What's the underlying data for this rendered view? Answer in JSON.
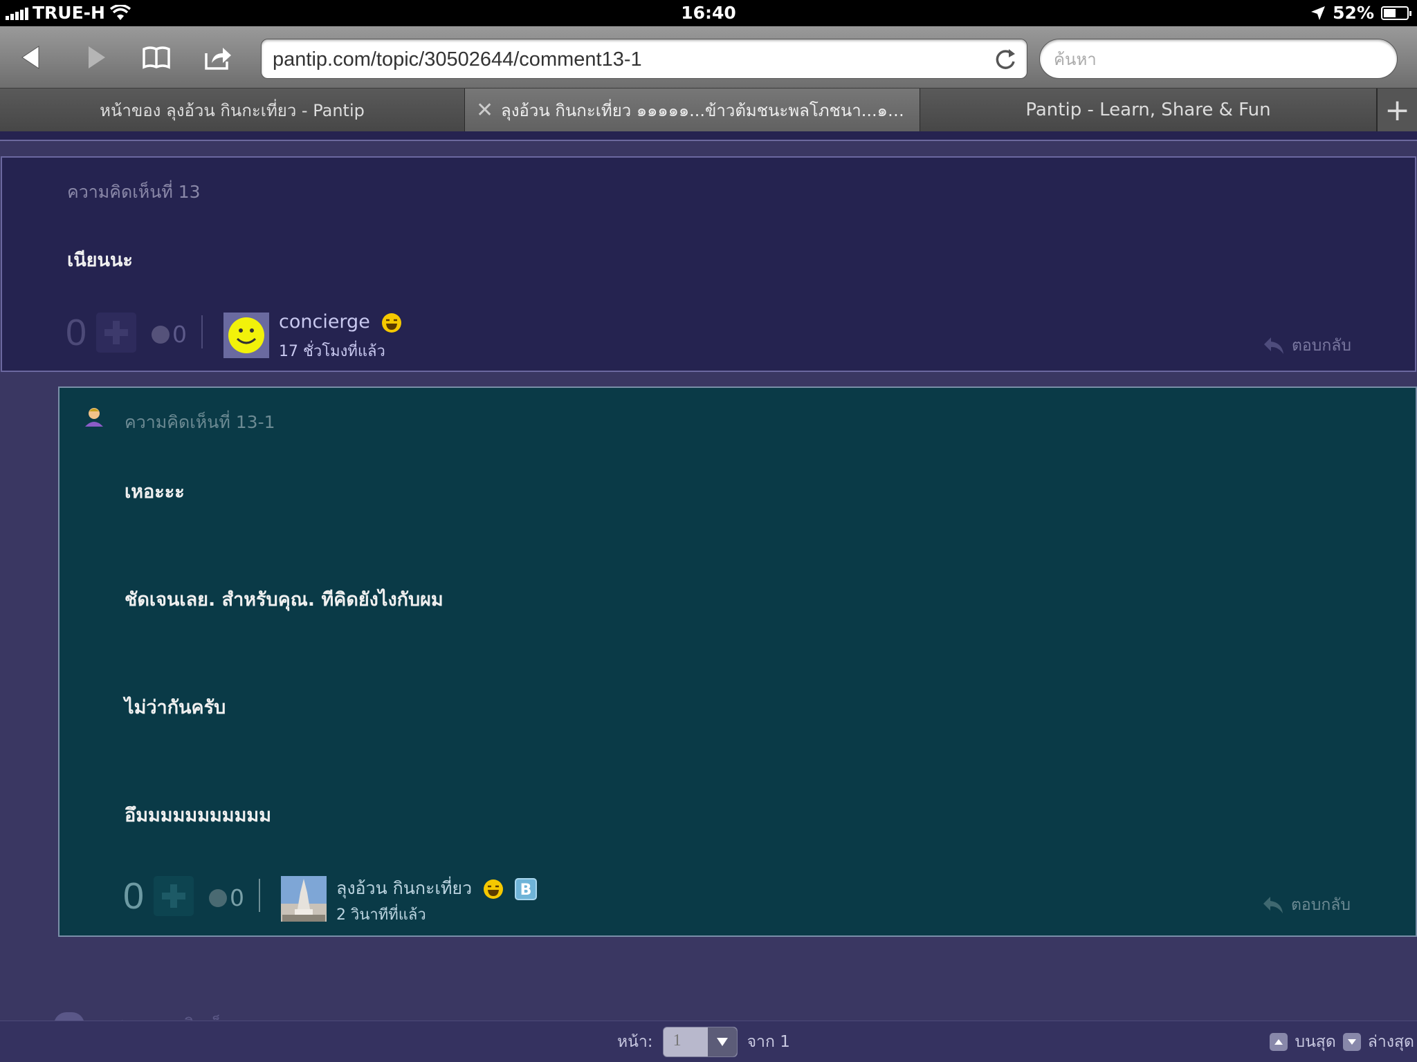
{
  "status_bar": {
    "carrier": "TRUE-H",
    "time": "16:40",
    "battery": "52%",
    "battery_level": 0.52
  },
  "browser": {
    "url": "pantip.com/topic/30502644/comment13-1",
    "search_placeholder": "ค้นหา",
    "tabs": [
      {
        "label": "หน้าของ ลุงอ้วน กินกะเที่ยว - Pantip"
      },
      {
        "label": "ลุงอ้วน กินกะเที่ยว ๑๑๑๑๑...ข้าวต้มชนะพลโภชนา...๑๑๑๑๑ -..."
      },
      {
        "label": "Pantip - Learn, Share & Fun"
      }
    ]
  },
  "comment_main": {
    "title": "ความคิดเห็นที่ 13",
    "text": "เนียนนะ",
    "score": "0",
    "emotion_count": "0",
    "username": "concierge",
    "time": "17 ชั่วโมงที่แล้ว",
    "reply_label": "ตอบกลับ"
  },
  "comment_reply": {
    "title": "ความคิดเห็นที่ 13-1",
    "lines": [
      "เหอะะะ",
      "ชัดเจนเลย. สำหรับคุณ. ทีคิดยังไงกับผม",
      "ไม่ว่ากันครับ",
      "อึมมมมมมมมมมม"
    ],
    "score": "0",
    "emotion_count": "0",
    "username": "ลุงอ้วน กินกะเที่ยว",
    "badge": "B",
    "time": "2 วินาทีที่แล้ว",
    "reply_label": "ตอบกลับ"
  },
  "footer": {
    "show_comments": "แสดงความคิดเห็น",
    "page_label": "หน้า:",
    "page_value": "1",
    "of_label": "จาก 1",
    "top_label": "บนสุด",
    "bottom_label": "ล่างสุด"
  }
}
